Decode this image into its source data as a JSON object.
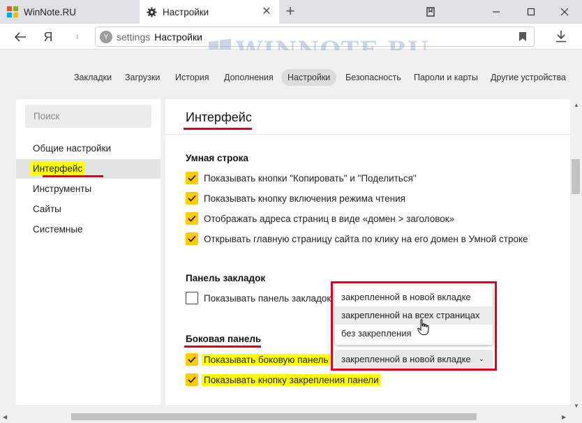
{
  "tabs": [
    {
      "title": "WinNote.RU",
      "icon": "windows-logo-icon"
    },
    {
      "title": "Настройки",
      "icon": "gear-icon"
    }
  ],
  "address": {
    "url": "settings",
    "title": "Настройки",
    "site_icon": "Y"
  },
  "nav": {
    "back_icon": "arrow-left-icon",
    "home_glyph": "Я"
  },
  "watermark": "WINNOTE.RU",
  "topnav": [
    "Закладки",
    "Загрузки",
    "История",
    "Дополнения",
    "Настройки",
    "Безопасность",
    "Пароли и карты",
    "Другие устройства"
  ],
  "topnav_active": "Настройки",
  "sidebar": {
    "search_placeholder": "Поиск",
    "items": [
      "Общие настройки",
      "Интерфейс",
      "Инструменты",
      "Сайты",
      "Системные"
    ],
    "active": "Интерфейс"
  },
  "main": {
    "title": "Интерфейс",
    "smart_line": {
      "heading": "Умная строка",
      "options": [
        {
          "label": "Показывать кнопки \"Копировать\" и \"Поделиться\"",
          "checked": true
        },
        {
          "label": "Показывать кнопку включения режима чтения",
          "checked": true
        },
        {
          "label": "Отображать адреса страниц в виде «домен > заголовок»",
          "checked": true
        },
        {
          "label": "Открывать главную страницу сайта по клику на его домен в Умной строке",
          "checked": true
        }
      ]
    },
    "bookmarks_bar": {
      "heading": "Панель закладок",
      "option": {
        "label": "Показывать панель закладок",
        "checked": false
      }
    },
    "side_panel": {
      "heading": "Боковая панель",
      "options": [
        {
          "label": "Показывать боковую панель",
          "checked": true
        },
        {
          "label": "Показывать кнопку закрепления панели",
          "checked": true
        }
      ],
      "select_value": "закрепленной в новой вкладке",
      "dropdown_options": [
        "закрепленной в новой вкладке",
        "закрепленной на всех страницах",
        "без закрепления"
      ],
      "hovered_option": "закрепленной на всех страницах"
    }
  },
  "colors": {
    "accent_checkbox": "#ffcc00",
    "highlight": "#ffff00",
    "annotation_red": "#e3001b"
  }
}
